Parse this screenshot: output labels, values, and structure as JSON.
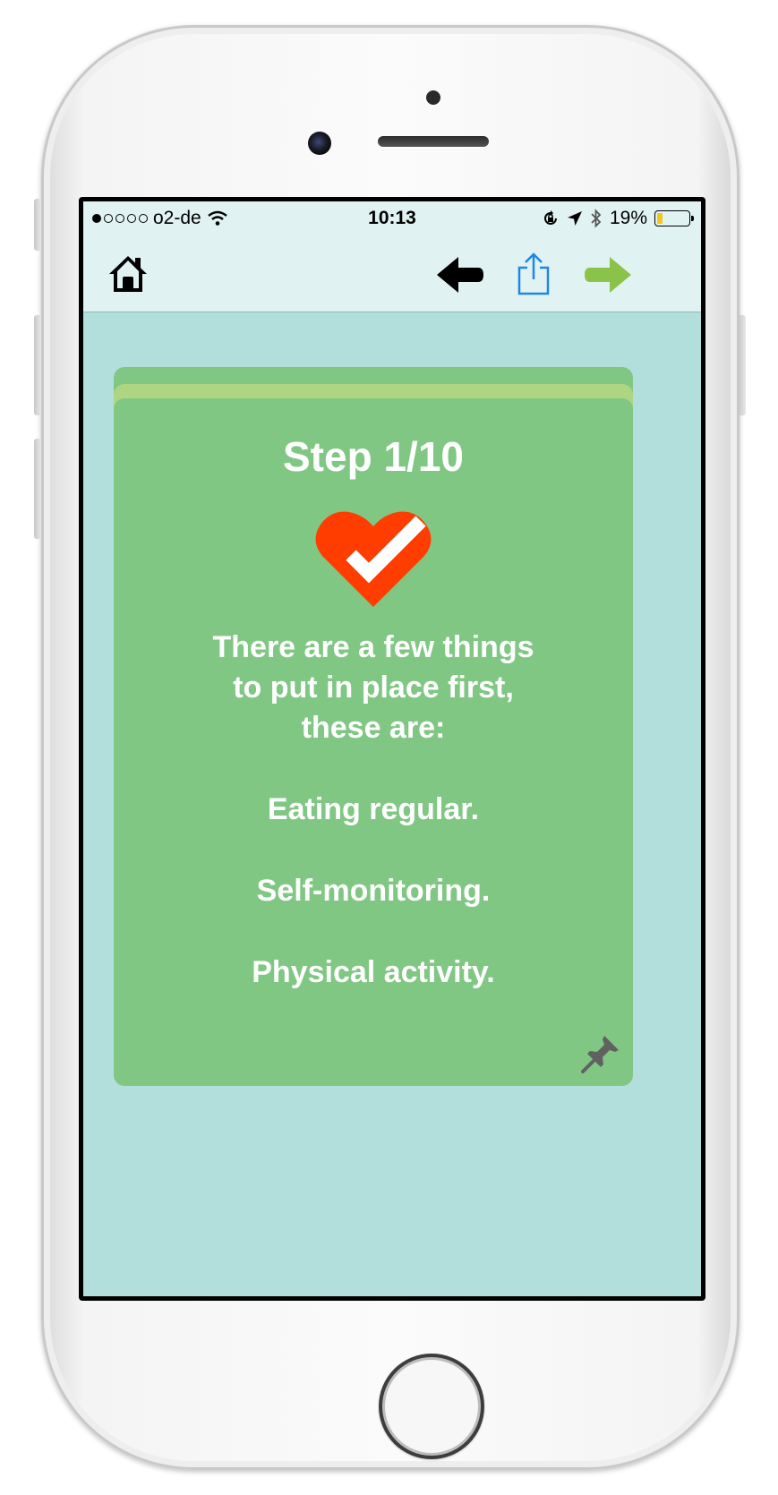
{
  "status_bar": {
    "carrier": "o2-de",
    "time": "10:13",
    "battery_percent_label": "19%",
    "battery_level": 0.19
  },
  "nav": {
    "home_icon": "home-icon",
    "back_icon": "back-arrow-icon",
    "share_icon": "share-icon",
    "forward_icon": "forward-arrow-icon",
    "back_color": "#000000",
    "share_color": "#1e88e5",
    "forward_color": "#8bc34a"
  },
  "card": {
    "title": "Step 1/10",
    "icon": "heart-check-icon",
    "heart_color": "#ff3d00",
    "intro_line1": "There are a few things",
    "intro_line2": "to put in place first,",
    "intro_line3": "these are:",
    "item1": "Eating regular.",
    "item2": "Self-monitoring.",
    "item3": "Physical activity.",
    "pin_icon": "pin-icon"
  },
  "colors": {
    "screen_bg": "#b2dfdb",
    "bar_bg": "#e0f2f1",
    "card_bg": "#81c784",
    "card_accent": "#aed581"
  }
}
